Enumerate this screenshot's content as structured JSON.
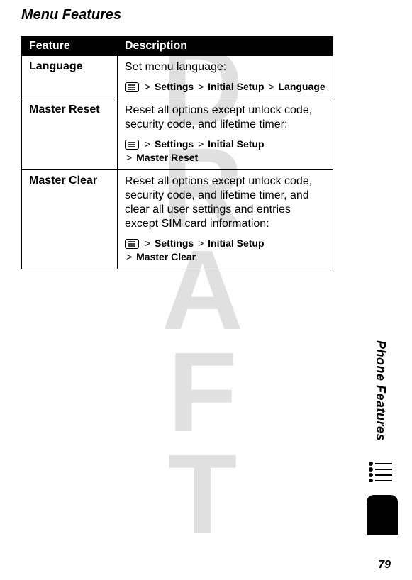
{
  "watermark": "DRAFT",
  "section_title": "Menu Features",
  "table": {
    "headers": {
      "feature": "Feature",
      "description": "Description"
    },
    "rows": [
      {
        "feature": "Language",
        "desc": "Set menu language:",
        "path_parts": [
          "Settings",
          "Initial Setup",
          "Language"
        ]
      },
      {
        "feature": "Master Reset",
        "desc": "Reset all options except unlock code, security code, and lifetime timer:",
        "path_parts": [
          "Settings",
          "Initial Setup",
          "Master Reset"
        ]
      },
      {
        "feature": "Master Clear",
        "desc": "Reset all options except unlock code, security code, and lifetime timer, and clear all user settings and entries except SIM card information:",
        "path_parts": [
          "Settings",
          "Initial Setup",
          "Master Clear"
        ]
      }
    ]
  },
  "side_label": "Phone Features",
  "page_number": "79"
}
